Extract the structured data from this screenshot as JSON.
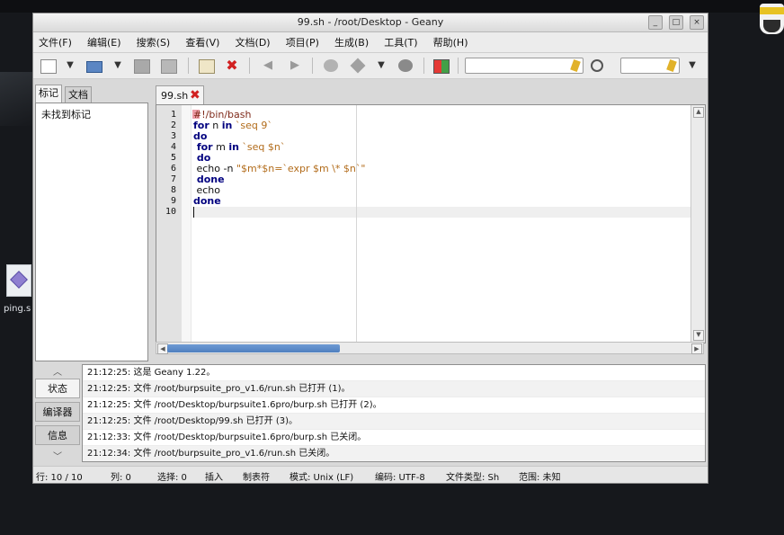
{
  "desktop": {
    "icon_label": "ping.s"
  },
  "window": {
    "title": "99.sh - /root/Desktop - Geany"
  },
  "menu": [
    "文件(F)",
    "编辑(E)",
    "搜索(S)",
    "查看(V)",
    "文档(D)",
    "项目(P)",
    "生成(B)",
    "工具(T)",
    "帮助(H)"
  ],
  "toolbar": {
    "icons": {
      "new": "new-file-icon",
      "open": "open-folder-icon",
      "save": "save-icon",
      "save_all": "save-all-icon",
      "revert": "revert-icon",
      "close": "close-file-icon",
      "back": "back-arrow-icon",
      "forward": "forward-arrow-icon",
      "compile": "compile-icon",
      "build": "build-icon",
      "execute": "execute-icon",
      "color": "color-chooser-icon",
      "search": "search-icon",
      "clear": "broom-clear-icon"
    },
    "search_value": "",
    "goto_value": ""
  },
  "sidebar": {
    "tabs": [
      "标记",
      "文档"
    ],
    "empty_text": "未找到标记"
  },
  "editor": {
    "tab_label": "99.sh",
    "line_numbers": [
      "1",
      "2",
      "3",
      "4",
      "5",
      "6",
      "7",
      "8",
      "9",
      "10"
    ],
    "lines": [
      {
        "segs": [
          {
            "t": "#!/bin/bash",
            "c": "#7f2a1a"
          }
        ]
      },
      {
        "segs": [
          {
            "t": "for",
            "c": "#00007f",
            "b": true
          },
          {
            "t": " n ",
            "c": "#111111"
          },
          {
            "t": "in",
            "c": "#00007f",
            "b": true
          },
          {
            "t": " `seq 9`",
            "c": "#b26c1b"
          }
        ]
      },
      {
        "segs": [
          {
            "t": "do",
            "c": "#00007f",
            "b": true
          }
        ]
      },
      {
        "segs": [
          {
            "t": " for",
            "c": "#00007f",
            "b": true
          },
          {
            "t": " m ",
            "c": "#111111"
          },
          {
            "t": "in",
            "c": "#00007f",
            "b": true
          },
          {
            "t": " `seq $n`",
            "c": "#b26c1b"
          }
        ]
      },
      {
        "segs": [
          {
            "t": " do",
            "c": "#00007f",
            "b": true
          }
        ]
      },
      {
        "segs": [
          {
            "t": " echo -n ",
            "c": "#111111"
          },
          {
            "t": "\"$m*$n=`expr $m \\* $n`\"",
            "c": "#b26c1b"
          }
        ]
      },
      {
        "segs": [
          {
            "t": " done",
            "c": "#00007f",
            "b": true
          }
        ]
      },
      {
        "segs": [
          {
            "t": " echo",
            "c": "#111111"
          }
        ]
      },
      {
        "segs": [
          {
            "t": "done",
            "c": "#00007f",
            "b": true
          }
        ]
      },
      {
        "segs": [
          {
            "t": "",
            "c": "#111111"
          }
        ]
      }
    ]
  },
  "messages": {
    "tabs": [
      "状态",
      "编译器",
      "信息"
    ],
    "items": [
      "21:12:25: 这是 Geany 1.22。",
      "21:12:25: 文件 /root/burpsuite_pro_v1.6/run.sh 已打开 (1)。",
      "21:12:25: 文件 /root/Desktop/burpsuite1.6pro/burp.sh 已打开 (2)。",
      "21:12:25: 文件 /root/Desktop/99.sh 已打开 (3)。",
      "21:12:33: 文件 /root/Desktop/burpsuite1.6pro/burp.sh 已关闭。",
      "21:12:34: 文件 /root/burpsuite_pro_v1.6/run.sh 已关闭。"
    ]
  },
  "status": {
    "line": "行: 10 / 10",
    "col": "列: 0",
    "sel": "选择: 0",
    "mode": "插入",
    "indent": "制表符",
    "eol": "模式: Unix (LF)",
    "enc": "编码: UTF-8",
    "ftype": "文件类型: Sh",
    "scope": "范围: 未知"
  }
}
